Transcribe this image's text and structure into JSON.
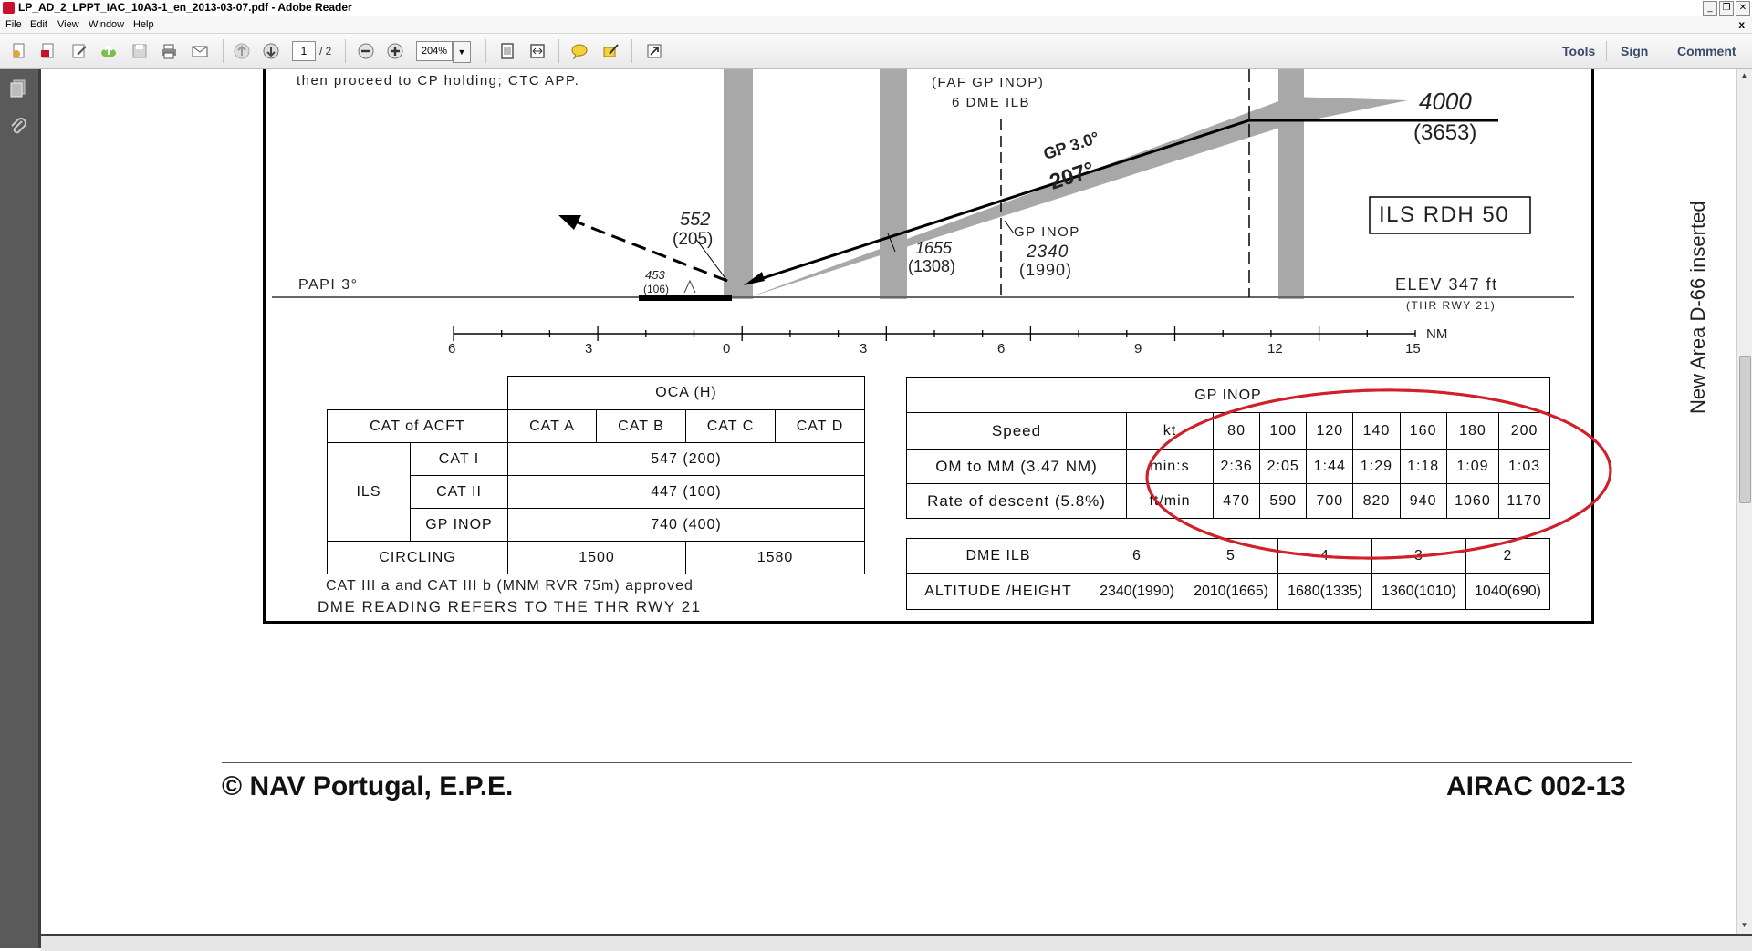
{
  "window": {
    "title": "LP_AD_2_LPPT_IAC_10A3-1_en_2013-03-07.pdf - Adobe Reader",
    "controls": [
      "_",
      "❐",
      "✕"
    ],
    "doc_close": "x"
  },
  "menu": [
    "File",
    "Edit",
    "View",
    "Window",
    "Help"
  ],
  "toolbar": {
    "page_current": "1",
    "page_total": "/ 2",
    "zoom": "204%",
    "right_links": [
      "Tools",
      "Sign",
      "Comment"
    ]
  },
  "chart": {
    "top_note": "then proceed to CP holding; CTC APP.",
    "faf_line1": "(FAF GP INOP)",
    "faf_line2": "6 DME ILB",
    "gp_label": "GP 3.0°",
    "gp_track": "207°",
    "alt_main": "4000",
    "alt_height": "(3653)",
    "ils_rdh": "ILS RDH 50",
    "papi": "PAPI 3°",
    "pt552": "552",
    "pt205": "(205)",
    "pt453": "453",
    "pt106": "(106)",
    "pt1655": "1655",
    "pt1308": "(1308)",
    "gpinop_label": "GP INOP",
    "gpinop_alt": "2340",
    "gpinop_height": "(1990)",
    "elev": "ELEV 347 ft",
    "thr": "(THR RWY 21)",
    "scale_labels": [
      "6",
      "3",
      "0",
      "3",
      "6",
      "9",
      "12",
      "15"
    ],
    "scale_unit": "NM",
    "side_note": "New Area D-66 inserted"
  },
  "oca_table": {
    "header": "OCA (H)",
    "cat_label": "CAT of ACFT",
    "cats": [
      "CAT A",
      "CAT B",
      "CAT C",
      "CAT D"
    ],
    "ils": "ILS",
    "rows": [
      {
        "label": "CAT I",
        "value": "547 (200)"
      },
      {
        "label": "CAT II",
        "value": "447 (100)"
      },
      {
        "label": "GP INOP",
        "value": "740 (400)"
      }
    ],
    "circling": "CIRCLING",
    "circ_ab": "1500",
    "circ_cd": "1580"
  },
  "notes": {
    "cat3": "CAT III a and CAT III b (MNM RVR 75m) approved",
    "dme": "DME READING REFERS TO THE THR RWY 21"
  },
  "speed_table": {
    "header": "GP INOP",
    "speed": "Speed",
    "kt": "kt",
    "speeds": [
      "80",
      "100",
      "120",
      "140",
      "160",
      "180",
      "200"
    ],
    "om_label": "OM to MM (3.47 NM)",
    "mins": "min:s",
    "times": [
      "2:36",
      "2:05",
      "1:44",
      "1:29",
      "1:18",
      "1:09",
      "1:03"
    ],
    "rate_label": "Rate of descent (5.8%)",
    "ftmin": "ft/min",
    "rates": [
      "470",
      "590",
      "700",
      "820",
      "940",
      "1060",
      "1170"
    ]
  },
  "dme_table": {
    "dme_label": "DME ILB",
    "dmes": [
      "6",
      "5",
      "4",
      "3",
      "2"
    ],
    "alt_label": "ALTITUDE /HEIGHT",
    "alts": [
      "2340(1990)",
      "2010(1665)",
      "1680(1335)",
      "1360(1010)",
      "1040(690)"
    ]
  },
  "footer": {
    "copyright": "© NAV Portugal, E.P.E.",
    "airac": "AIRAC 002-13"
  },
  "colors": {
    "annotation_circle": "#d0202a",
    "gp_wedge": "#a8a8a8",
    "nav_panel": "#5a5a5a"
  }
}
